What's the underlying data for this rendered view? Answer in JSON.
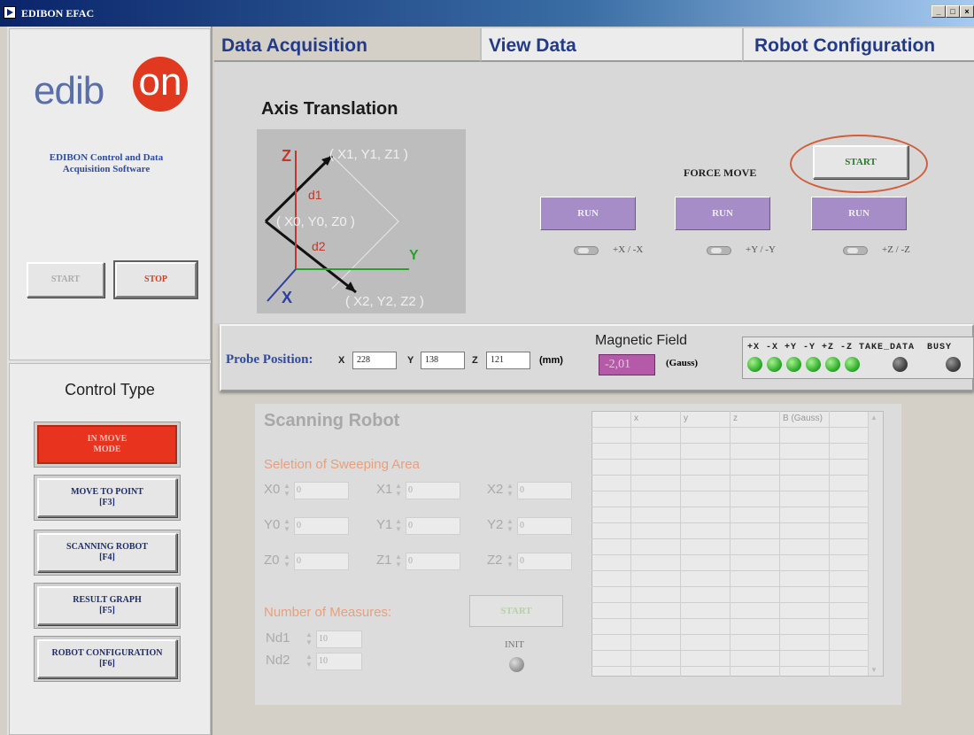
{
  "window": {
    "title": "EDIBON EFAC"
  },
  "brand": {
    "logo_pre": "edib",
    "logo_circle": "on",
    "software_title": "EDIBON Control and Data Acquisition Software"
  },
  "left": {
    "start_label": "START",
    "stop_label": "STOP",
    "control_type": "Control Type"
  },
  "modes": [
    {
      "label": "IN MOVE\nMODE",
      "active": true
    },
    {
      "label": "MOVE TO POINT\n[F3]"
    },
    {
      "label": "SCANNING ROBOT\n[F4]"
    },
    {
      "label": "RESULT GRAPH\n[F5]"
    },
    {
      "label": "ROBOT CONFIGURATION\n[F6]"
    }
  ],
  "tabs": [
    "Data Acquisition",
    "View Data",
    "Robot Configuration"
  ],
  "axis": {
    "title": "Axis Translation",
    "z": "Z",
    "y": "Y",
    "x": "X",
    "p1": "( X1, Y1, Z1 )",
    "p0": "( X0, Y0, Z0 )",
    "p2": "( X2, Y2, Z2 )",
    "d1": "d1",
    "d2": "d2"
  },
  "force_move": {
    "label": "FORCE MOVE",
    "start": "START"
  },
  "run": [
    {
      "label": "RUN",
      "axis": "+X / -X"
    },
    {
      "label": "RUN",
      "axis": "+Y / -Y"
    },
    {
      "label": "RUN",
      "axis": "+Z / -Z"
    }
  ],
  "probe": {
    "label": "Probe Position:",
    "x_lbl": "X",
    "y_lbl": "Y",
    "z_lbl": "Z",
    "x": "228",
    "y": "138",
    "z": "121",
    "unit": "(mm)"
  },
  "magnetic": {
    "title": "Magnetic Field",
    "value": "-2,01",
    "unit": "(Gauss)"
  },
  "leds": {
    "labels": "+X -X +Y -Y +Z -Z TAKE_DATA  BUSY"
  },
  "scanning": {
    "title": "Scanning Robot",
    "sweep_title": "Seletion of Sweeping Area",
    "coords": [
      {
        "label": "X0",
        "value": "0"
      },
      {
        "label": "X1",
        "value": "0"
      },
      {
        "label": "X2",
        "value": "0"
      },
      {
        "label": "Y0",
        "value": "0"
      },
      {
        "label": "Y1",
        "value": "0"
      },
      {
        "label": "Y2",
        "value": "0"
      },
      {
        "label": "Z0",
        "value": "0"
      },
      {
        "label": "Z1",
        "value": "0"
      },
      {
        "label": "Z2",
        "value": "0"
      }
    ],
    "measures_title": "Number of Measures:",
    "start": "START",
    "init": "INIT",
    "nd1_label": "Nd1",
    "nd1_value": "10",
    "nd2_label": "Nd2",
    "nd2_value": "10"
  },
  "table": {
    "headers": [
      "x",
      "y",
      "z",
      "B (Gauss)"
    ]
  }
}
